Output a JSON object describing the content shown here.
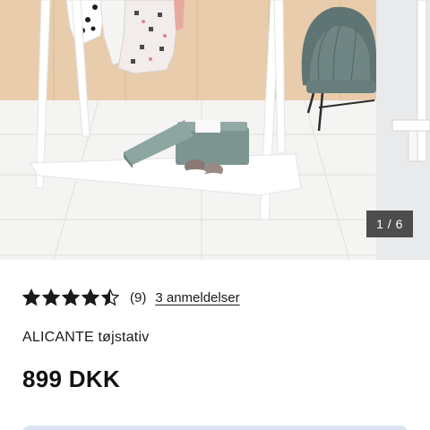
{
  "gallery": {
    "image_alt": "ALICANTE tøjstativ",
    "counter": "1 / 6"
  },
  "rating": {
    "stars": 4.5,
    "count": "(9)",
    "reviews_link": "3 anmeldelser"
  },
  "product": {
    "name": "ALICANTE tøjstativ",
    "price": "899 DKK"
  },
  "colors": {
    "text": "#1a1a1a",
    "counter_bg": "#4d4d4d",
    "cta_hint": "#dde3f2"
  }
}
